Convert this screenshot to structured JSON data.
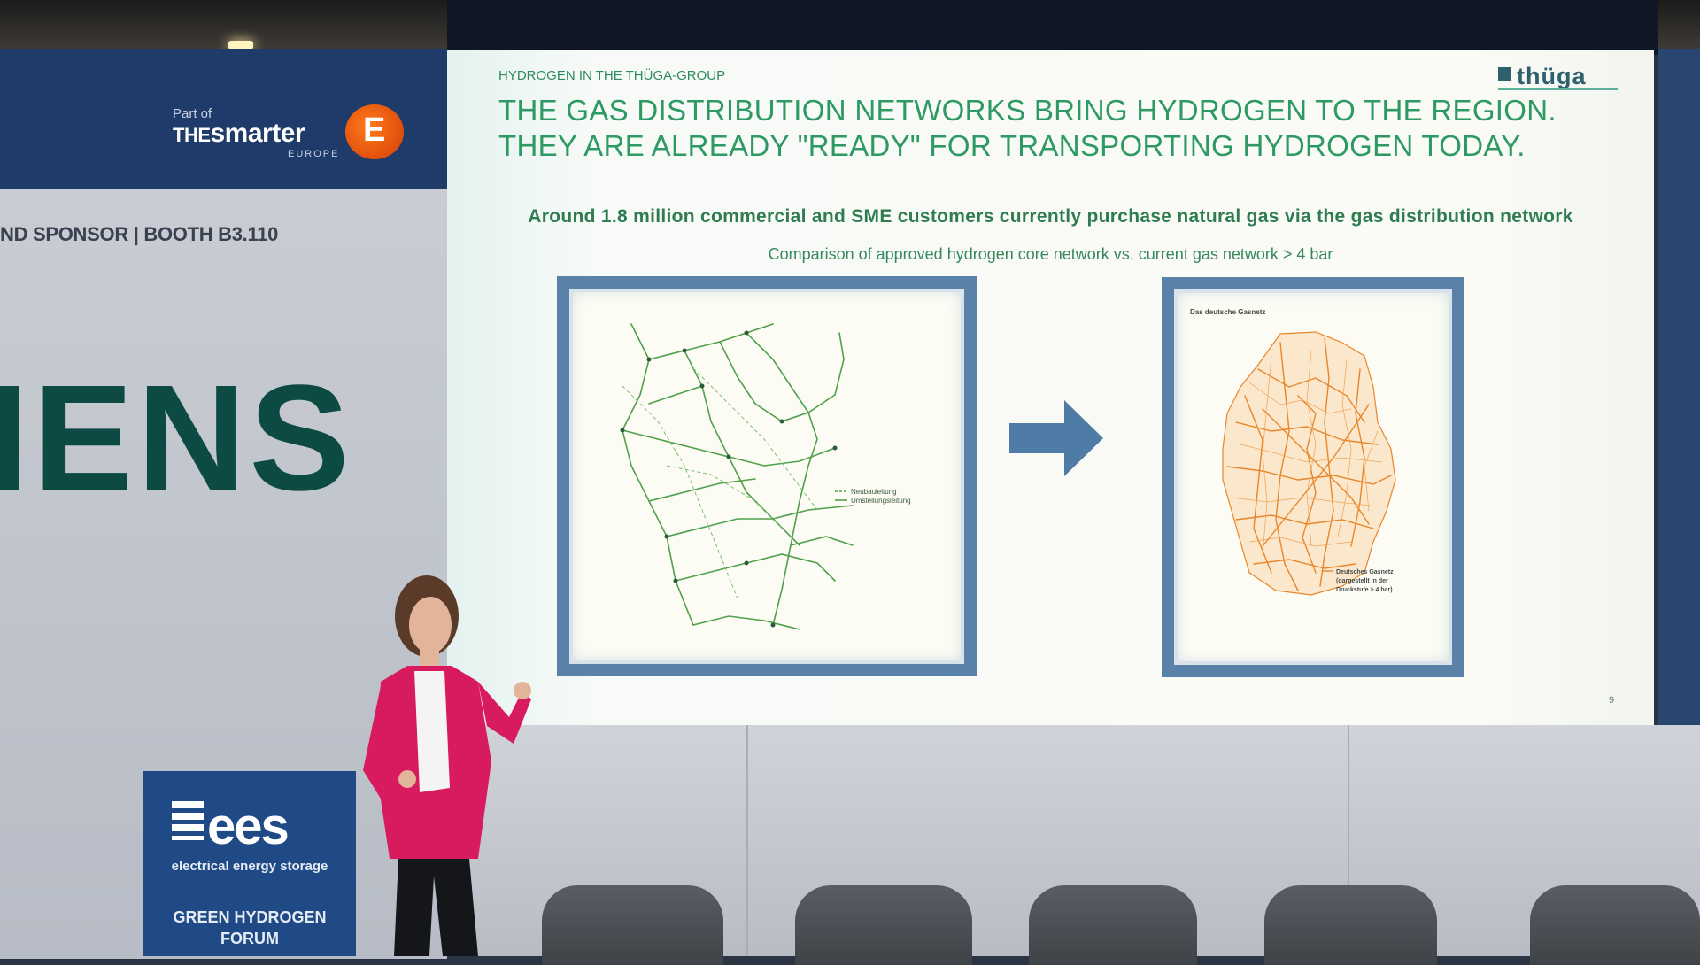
{
  "stage": {
    "sponsor_banner": {
      "part_of": "Part of",
      "brand_the": "THE",
      "brand_smarter": "smarter",
      "brand_region": "EUROPE",
      "logo_letter": "E"
    },
    "sponsor_text": "ND SPONSOR | BOOTH B3.110",
    "siemens_fragment": "IENS",
    "ees_sign": {
      "logo_text": "ees",
      "subtitle": "electrical energy storage",
      "forum_line1": "GREEN HYDROGEN",
      "forum_line2": "FORUM"
    }
  },
  "slide": {
    "kicker": "HYDROGEN IN THE THÜGA-GROUP",
    "logo_text": "thüga",
    "title_line1": "THE GAS DISTRIBUTION NETWORKS BRING HYDROGEN TO THE REGION.",
    "title_line2": "THEY ARE ALREADY \"READY\" FOR TRANSPORTING HYDROGEN TODAY.",
    "subtitle": "Around 1.8 million commercial and SME customers currently purchase natural gas via the gas distribution network",
    "caption": "Comparison of approved hydrogen core network vs. current gas network > 4 bar",
    "left_map": {
      "legend": [
        "Neubauleitung",
        "Umstellungsleitung"
      ]
    },
    "right_map": {
      "map_title": "Das deutsche Gasnetz",
      "legend_line1": "Deutsches Gasnetz",
      "legend_line2": "(dargestellt in der",
      "legend_line3": "Druckstufe > 4 bar)"
    },
    "page_number": "9"
  },
  "colors": {
    "slide_green": "#2e9a63",
    "frame_blue": "#5a82a8",
    "arrow_blue": "#4f7ca6",
    "gas_network_orange": "#e8862a",
    "hydrogen_green": "#4fa04a"
  }
}
